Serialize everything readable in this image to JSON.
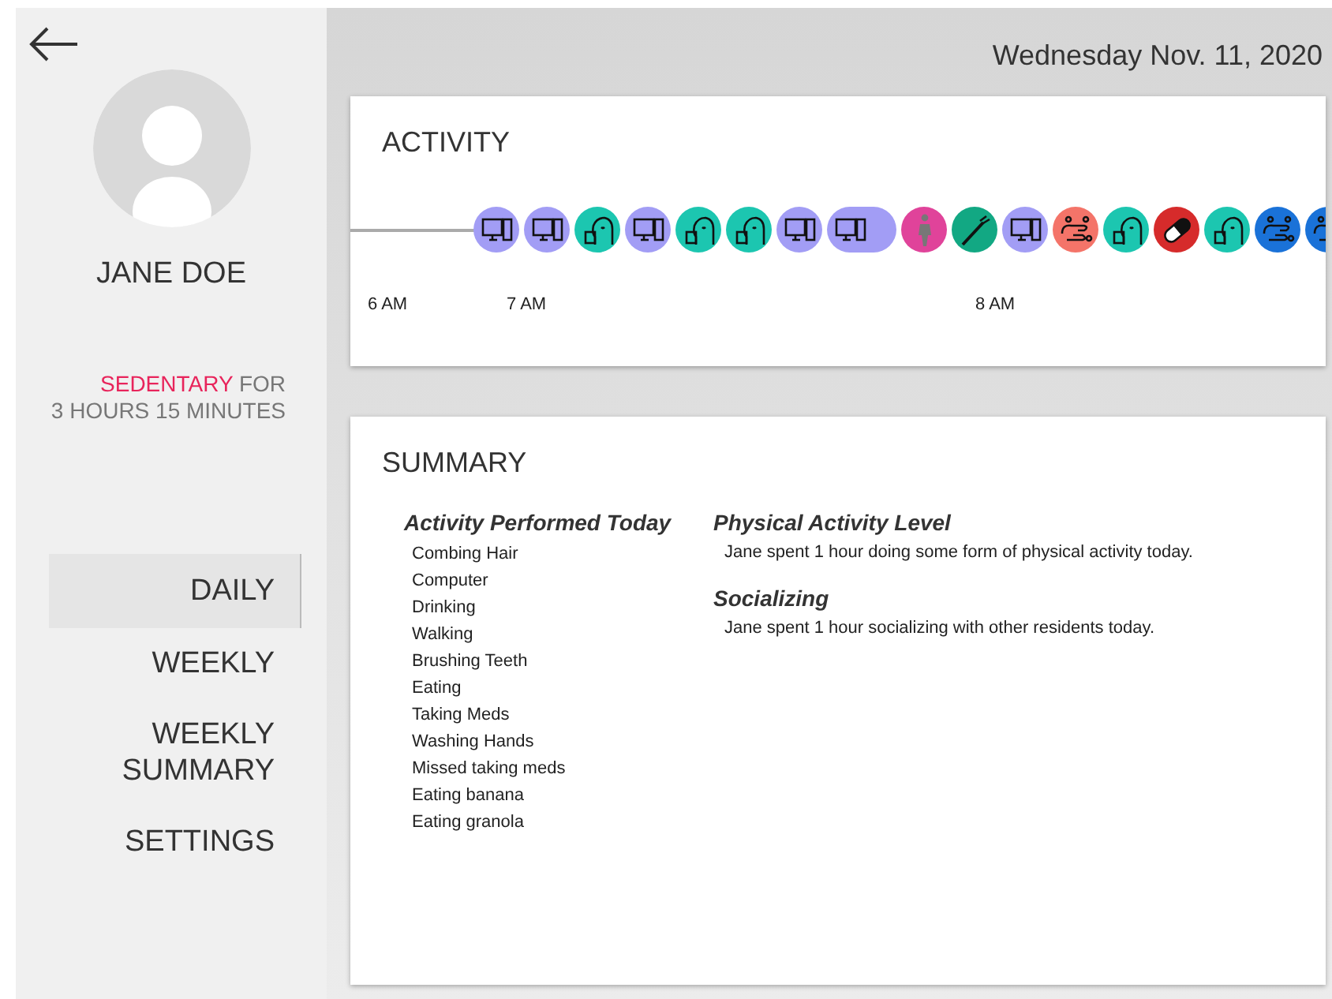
{
  "profile": {
    "name": "JANE DOE",
    "status": "SEDENTARY",
    "status_rest": "FOR",
    "duration": "3 HOURS 15 MINUTES"
  },
  "nav": [
    {
      "label": "DAILY",
      "selected": true
    },
    {
      "label": "WEEKLY",
      "selected": false
    },
    {
      "label": "WEEKLY SUMMARY",
      "selected": false
    },
    {
      "label": "SETTINGS",
      "selected": false
    }
  ],
  "date": "Wednesday Nov. 11, 2020",
  "activity": {
    "title": "ACTIVITY",
    "ticks": [
      "6 AM",
      "7 AM",
      "8 AM"
    ],
    "events": [
      {
        "kind": "computer",
        "color": "#a29df5",
        "long": false
      },
      {
        "kind": "computer",
        "color": "#a29df5",
        "long": false
      },
      {
        "kind": "eating",
        "color": "#1cc6b0",
        "long": false
      },
      {
        "kind": "computer",
        "color": "#a29df5",
        "long": false
      },
      {
        "kind": "eating",
        "color": "#1cc6b0",
        "long": false
      },
      {
        "kind": "eating",
        "color": "#1cc6b0",
        "long": false
      },
      {
        "kind": "computer",
        "color": "#a29df5",
        "long": false
      },
      {
        "kind": "computer",
        "color": "#a29df5",
        "long": true
      },
      {
        "kind": "walking",
        "color": "#e0439a",
        "long": false
      },
      {
        "kind": "brushing",
        "color": "#12a883",
        "long": false
      },
      {
        "kind": "computer",
        "color": "#a29df5",
        "long": false
      },
      {
        "kind": "washing",
        "color": "#f47469",
        "long": false
      },
      {
        "kind": "eating",
        "color": "#1cc6b0",
        "long": false
      },
      {
        "kind": "meds",
        "color": "#d62b2b",
        "long": false
      },
      {
        "kind": "eating",
        "color": "#1cc6b0",
        "long": false
      },
      {
        "kind": "washing",
        "color": "#1a72d8",
        "long": false
      },
      {
        "kind": "washing",
        "color": "#1a72d8",
        "long": false
      }
    ]
  },
  "summary": {
    "title": "SUMMARY",
    "list_heading": "Activity Performed Today",
    "activities": [
      "Combing Hair",
      "Computer",
      "Drinking",
      "Walking",
      "Brushing Teeth",
      "Eating",
      "Taking Meds",
      "Washing Hands",
      "Missed taking meds",
      "Eating banana",
      "Eating granola"
    ],
    "sections": [
      {
        "heading": "Physical Activity Level",
        "text": "Jane spent 1 hour doing some form of physical activity today."
      },
      {
        "heading": "Socializing",
        "text": "Jane spent 1 hour socializing with other residents today."
      }
    ]
  }
}
